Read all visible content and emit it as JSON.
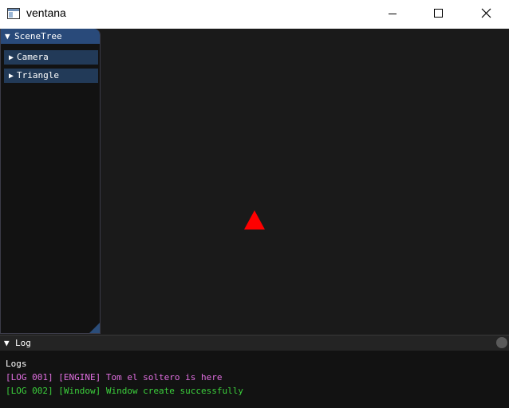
{
  "window": {
    "title": "ventana",
    "icon": "app-window-icon",
    "controls": [
      "minimize-icon",
      "maximize-icon",
      "close-icon"
    ]
  },
  "scene_tree": {
    "title": "SceneTree",
    "items": [
      {
        "label": "Camera",
        "icon": "triangle-right-icon"
      },
      {
        "label": "Triangle",
        "icon": "triangle-right-icon"
      }
    ]
  },
  "viewport": {
    "shape": "triangle",
    "shape_color": "#ff0000",
    "background": "#1a1a1a"
  },
  "log": {
    "title": "Log",
    "heading": "Logs",
    "lines": [
      {
        "text": "[LOG 001] [ENGINE] Tom el soltero is here",
        "color": "#e06fe0"
      },
      {
        "text": "[LOG 002] [Window] Window create successfully",
        "color": "#3cd13c"
      }
    ]
  },
  "colors": {
    "header_active": "#294a7a",
    "tree_item": "#223a58",
    "panel_bg": "#121212"
  }
}
